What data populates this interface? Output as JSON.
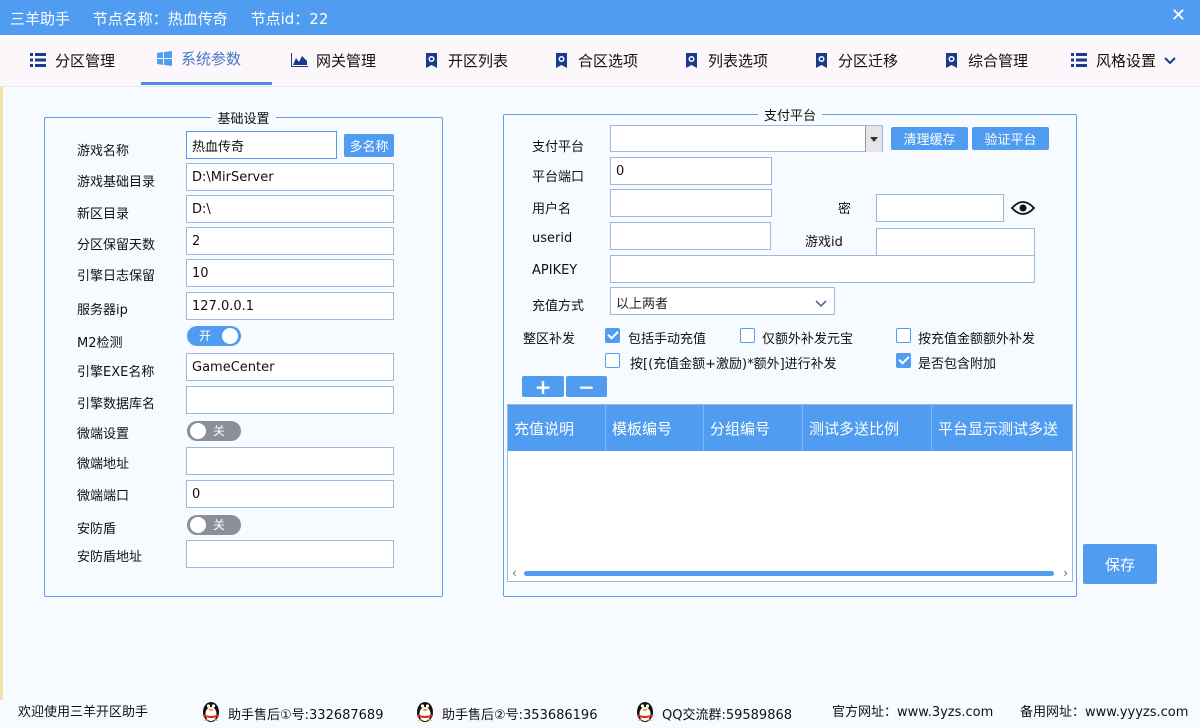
{
  "titlebar": {
    "app": "三羊助手",
    "node_name": "节点名称：热血传奇",
    "node_id": "节点id：22",
    "close": "✕"
  },
  "tabs": [
    {
      "label": "分区管理",
      "icon": "list-icon"
    },
    {
      "label": "系统参数",
      "icon": "windows-icon"
    },
    {
      "label": "网关管理",
      "icon": "area-chart-icon"
    },
    {
      "label": "开区列表",
      "icon": "badge-icon"
    },
    {
      "label": "合区选项",
      "icon": "badge-icon"
    },
    {
      "label": "列表选项",
      "icon": "badge-icon"
    },
    {
      "label": "分区迁移",
      "icon": "badge-icon"
    },
    {
      "label": "综合管理",
      "icon": "badge-icon"
    },
    {
      "label": "风格设置",
      "icon": "list-icon"
    }
  ],
  "basic": {
    "legend": "基础设置",
    "game_name_label": "游戏名称",
    "game_name": "热血传奇",
    "multi_name_btn": "多名称",
    "base_dir_label": "游戏基础目录",
    "base_dir": "D:\\MirServer",
    "new_dir_label": "新区目录",
    "new_dir": "D:\\",
    "keep_days_label": "分区保留天数",
    "keep_days": "2",
    "engine_log_label": "引擎日志保留",
    "engine_log": "10",
    "server_ip_label": "服务器ip",
    "server_ip": "127.0.0.1",
    "m2_label": "M2检测",
    "m2_toggle": "开",
    "engine_exe_label": "引擎EXE名称",
    "engine_exe": "GameCenter",
    "engine_db_label": "引擎数据库名",
    "engine_db": "",
    "micro_label": "微端设置",
    "micro_toggle": "关",
    "micro_addr_label": "微端地址",
    "micro_addr": "",
    "micro_port_label": "微端端口",
    "micro_port": "0",
    "shield_label": "安防盾",
    "shield_toggle": "关",
    "shield_addr_label": "安防盾地址",
    "shield_addr": ""
  },
  "pay": {
    "legend": "支付平台",
    "platform_label": "支付平台",
    "platform_value": "",
    "clear_cache_btn": "清理缓存",
    "verify_btn": "验证平台",
    "port_label": "平台端口",
    "port": "0",
    "username_label": "用户名",
    "username": "",
    "password_label": "密",
    "password": "",
    "userid_label": "userid",
    "userid": "",
    "gameid_label": "游戏id",
    "gameid": "",
    "apikey_label": "APIKEY",
    "apikey": "",
    "method_label": "充值方式",
    "method_value": "以上两者",
    "supplement_label": "整区补发",
    "opt1": "包括手动充值",
    "opt2": "仅额外补发元宝",
    "opt3": "按充值金额额外补发",
    "opt4": "按[(充值金额+激励)*额外]进行补发",
    "opt5": "是否包含附加",
    "add_btn": "+",
    "remove_btn": "−",
    "columns": [
      "充值说明",
      "模板编号",
      "分组编号",
      "测试多送比例",
      "平台显示测试多送"
    ],
    "save_btn": "保存"
  },
  "footer": {
    "welcome": "欢迎使用三羊开区助手",
    "support1": "助手售后①号:332687689",
    "support2": "助手售后②号:353686196",
    "qq_group": "QQ交流群:59589868",
    "site": "官方网址：www.3yzs.com",
    "backup_site": "备用网址：www.yyyzs.com"
  },
  "colors": {
    "accent": "#4f9cf0",
    "tab_icon": "#1a3a8c"
  }
}
